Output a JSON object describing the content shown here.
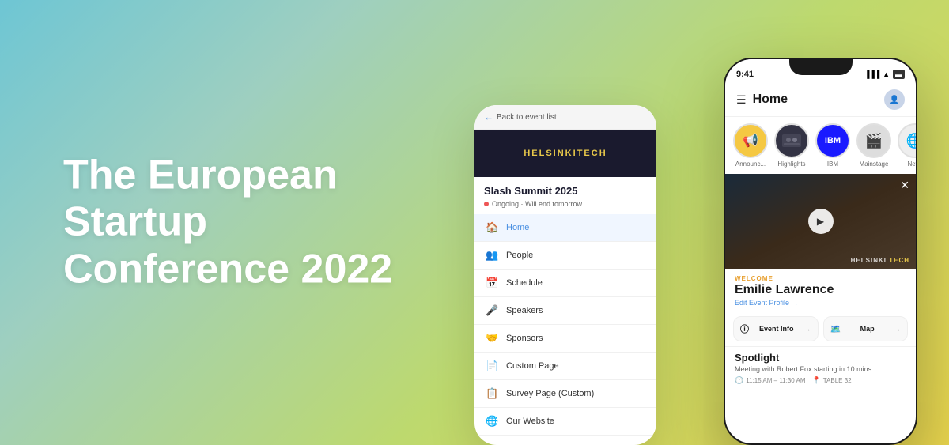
{
  "background": {
    "gradient": "linear-gradient(135deg, #6ec6d4 0%, #8ecfbb 30%, #c8d96e 70%, #e8d44d 100%)"
  },
  "hero": {
    "title": "The European Startup Conference 2022"
  },
  "phone_back": {
    "header": {
      "back_label": "Back to event list"
    },
    "banner": {
      "text1": "HELSINKITECH",
      "logo_main": "HELSINKI",
      "logo_accent": "TECH"
    },
    "event_title": "Slash Summit 2025",
    "status": "Ongoing · Will end tomorrow",
    "menu": [
      {
        "icon": "🏠",
        "label": "Home",
        "active": true
      },
      {
        "icon": "👥",
        "label": "People"
      },
      {
        "icon": "📅",
        "label": "Schedule"
      },
      {
        "icon": "🎤",
        "label": "Speakers"
      },
      {
        "icon": "🤝",
        "label": "Sponsors"
      },
      {
        "icon": "📄",
        "label": "Custom Page"
      },
      {
        "icon": "📋",
        "label": "Survey Page (Custom)"
      },
      {
        "icon": "🌐",
        "label": "Our Website"
      }
    ]
  },
  "phone_front": {
    "status_bar": {
      "time": "9:41",
      "signal": "●●●",
      "wifi": "▲",
      "battery": "▬"
    },
    "header": {
      "title": "Home"
    },
    "circles": [
      {
        "label": "Announc...",
        "type": "gold",
        "content": "📢"
      },
      {
        "label": "Highlights",
        "type": "photo",
        "content": "👥"
      },
      {
        "label": "IBM",
        "type": "ibm",
        "content": "IBM"
      },
      {
        "label": "Mainstage",
        "type": "stage",
        "content": "🎬"
      },
      {
        "label": "Net...",
        "type": "default",
        "content": "🌐"
      }
    ],
    "video": {
      "brand_main": "HELSINKI",
      "brand_accent": "TECH"
    },
    "welcome": {
      "label": "WELCOME",
      "name": "Emilie Lawrence",
      "edit_profile": "Edit Event Profile →"
    },
    "quick_links": [
      {
        "icon": "ℹ️",
        "label": "Event Info",
        "arrow": "→"
      },
      {
        "icon": "🗺️",
        "label": "Map",
        "arrow": "→"
      }
    ],
    "spotlight": {
      "title": "Spotlight",
      "description": "Meeting with Robert Fox starting in 10 mins",
      "time": "11:15 AM – 11:30 AM",
      "location": "TABLE 32",
      "time_icon": "🕐",
      "location_icon": "📍"
    }
  }
}
